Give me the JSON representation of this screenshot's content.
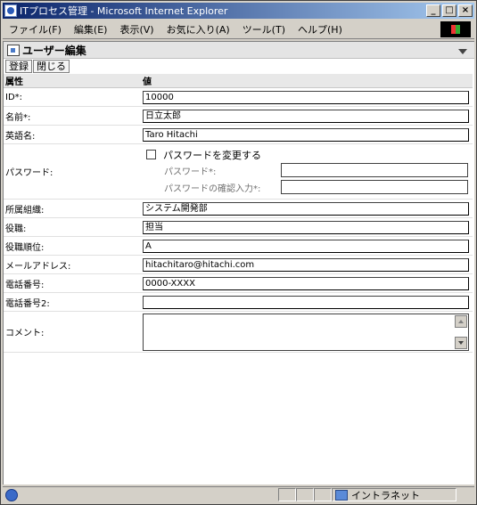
{
  "window": {
    "title": "ITプロセス管理 - Microsoft Internet Explorer",
    "buttons": {
      "minimize": "_",
      "maximize": "□",
      "close": "×"
    }
  },
  "menubar": {
    "items": [
      "ファイル(F)",
      "編集(E)",
      "表示(V)",
      "お気に入り(A)",
      "ツール(T)",
      "ヘルプ(H)"
    ]
  },
  "page": {
    "title": "ユーザー編集",
    "toolbar": {
      "register": "登録",
      "close": "閉じる"
    },
    "table": {
      "col_attr": "属性",
      "col_value": "値"
    },
    "rows": {
      "id": {
        "label": "ID*:",
        "value": "10000"
      },
      "name": {
        "label": "名前*:",
        "value": "日立太郎"
      },
      "english_name": {
        "label": "英語名:",
        "value": "Taro Hitachi"
      },
      "password": {
        "label": "パスワード:",
        "change_label": "パスワードを変更する",
        "password_label": "パスワード*:",
        "confirm_label": "パスワードの確認入力*:"
      },
      "department": {
        "label": "所属組織:",
        "value": "システム開発部"
      },
      "position": {
        "label": "役職:",
        "value": "担当"
      },
      "position_rank": {
        "label": "役職順位:",
        "value": "A"
      },
      "email": {
        "label": "メールアドレス:",
        "value": "hitachitaro@hitachi.com"
      },
      "phone": {
        "label": "電話番号:",
        "value": "0000-XXXX"
      },
      "phone2": {
        "label": "電話番号2:",
        "value": ""
      },
      "comment": {
        "label": "コメント:",
        "value": ""
      }
    }
  },
  "statusbar": {
    "zone": "イントラネット"
  }
}
